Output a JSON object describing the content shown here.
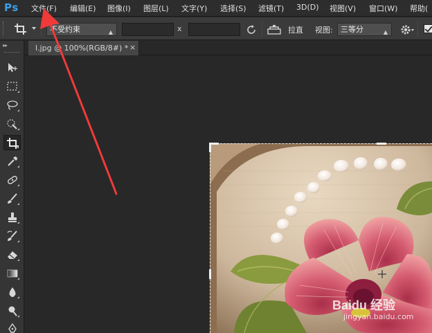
{
  "app": {
    "logo": "Ps"
  },
  "menu": [
    {
      "label": "文件(F)"
    },
    {
      "label": "编辑(E)"
    },
    {
      "label": "图像(I)"
    },
    {
      "label": "图层(L)"
    },
    {
      "label": "文字(Y)"
    },
    {
      "label": "选择(S)"
    },
    {
      "label": "滤镜(T)"
    },
    {
      "label": "3D(D)"
    },
    {
      "label": "视图(V)"
    },
    {
      "label": "窗口(W)"
    },
    {
      "label": "帮助("
    }
  ],
  "options": {
    "ratio_preset": "不受约束",
    "width_value": "",
    "height_value": "",
    "x_label": "x",
    "straighten_label": "拉直",
    "view_label": "视图:",
    "view_value": "三等分",
    "delete_cropped_checked": true
  },
  "document": {
    "tab_title": "l.jpg @ 100%(RGB/8#) *",
    "close_glyph": "×"
  },
  "watermark": {
    "brand": "Baidu 经验",
    "url": "jingyan.baidu.com"
  },
  "icons": {
    "tool": "crop-icon",
    "swap": "swap-icon",
    "straighten": "straighten-icon",
    "settings": "gear-icon"
  },
  "colors": {
    "accent": "#3d9ee8",
    "arrow": "#f03a3a",
    "panel": "#353535",
    "canvas": "#282828"
  }
}
